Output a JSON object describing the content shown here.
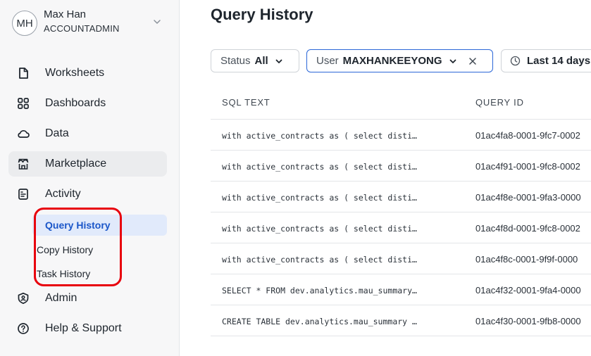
{
  "sidebar": {
    "user": {
      "initials": "MH",
      "name": "Max Han",
      "role": "ACCOUNTADMIN"
    },
    "items": [
      {
        "label": "Worksheets",
        "icon": "worksheet-icon"
      },
      {
        "label": "Dashboards",
        "icon": "dashboard-grid-icon"
      },
      {
        "label": "Data",
        "icon": "cloud-icon"
      },
      {
        "label": "Marketplace",
        "icon": "storefront-icon"
      },
      {
        "label": "Activity",
        "icon": "activity-document-icon"
      },
      {
        "label": "Admin",
        "icon": "shield-icon"
      },
      {
        "label": "Help & Support",
        "icon": "help-circle-icon"
      }
    ],
    "activity_sub": [
      {
        "label": "Query History",
        "selected": true
      },
      {
        "label": "Copy History",
        "selected": false
      },
      {
        "label": "Task History",
        "selected": false
      }
    ],
    "highlight_color": "#e8000d"
  },
  "main": {
    "title": "Query History",
    "filters": {
      "status_label": "Status",
      "status_value": "All",
      "user_label": "User",
      "user_value": "MAXHANKEEYONG",
      "time_value": "Last 14 days"
    },
    "columns": [
      "SQL TEXT",
      "QUERY ID"
    ],
    "rows": [
      {
        "sql": "with active_contracts as ( select disti…",
        "query_id": "01ac4fa8-0001-9fc7-0002"
      },
      {
        "sql": "with active_contracts as ( select disti…",
        "query_id": "01ac4f91-0001-9fc8-0002"
      },
      {
        "sql": "with active_contracts as ( select disti…",
        "query_id": "01ac4f8e-0001-9fa3-0000"
      },
      {
        "sql": "with active_contracts as ( select disti…",
        "query_id": "01ac4f8d-0001-9fc8-0002"
      },
      {
        "sql": "with active_contracts as ( select disti…",
        "query_id": "01ac4f8c-0001-9f9f-0000"
      },
      {
        "sql": "SELECT * FROM dev.analytics.mau_summary…",
        "query_id": "01ac4f32-0001-9fa4-0000"
      },
      {
        "sql": "CREATE TABLE dev.analytics.mau_summary …",
        "query_id": "01ac4f30-0001-9fb8-0000"
      }
    ],
    "accent_color": "#2b67d8"
  }
}
